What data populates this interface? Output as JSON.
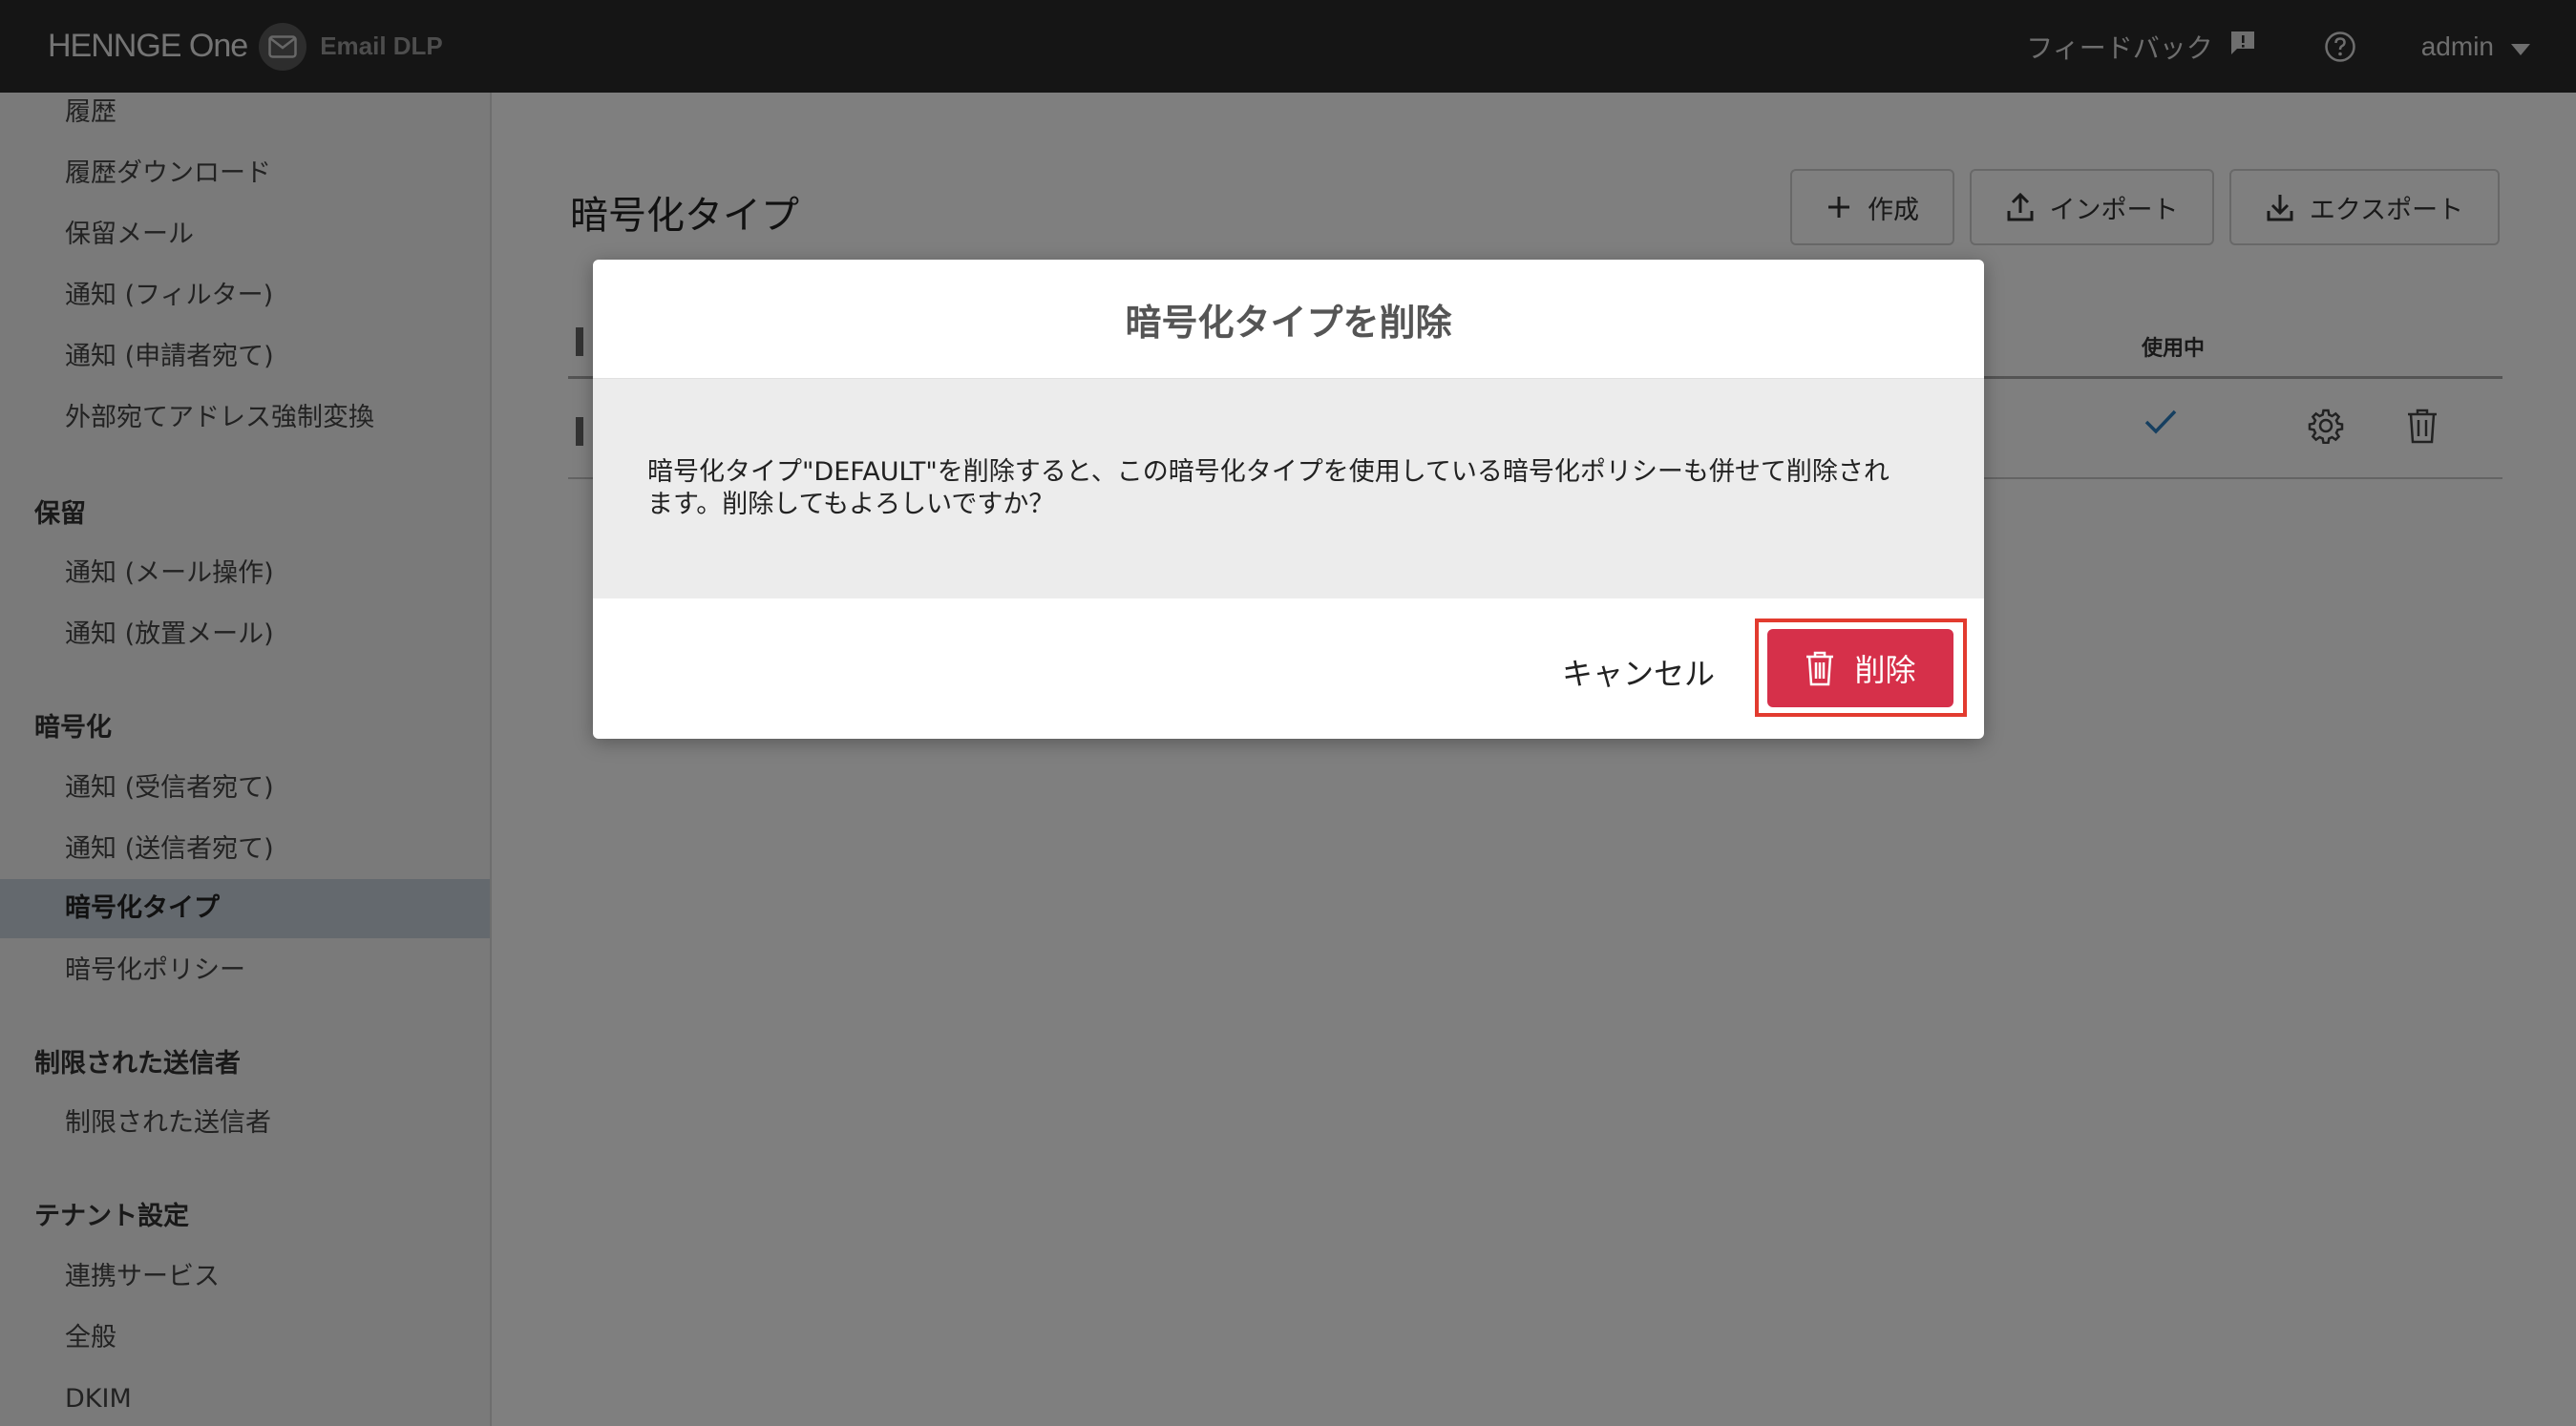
{
  "header": {
    "brand": "HENNGE One",
    "product": "Email DLP",
    "feedback_label": "フィードバック",
    "user": "admin"
  },
  "sidebar": {
    "items_top": [
      {
        "label": "履歴"
      },
      {
        "label": "履歴ダウンロード"
      },
      {
        "label": "保留メール"
      },
      {
        "label": "通知 (フィルター)"
      },
      {
        "label": "通知 (申請者宛て)"
      },
      {
        "label": "外部宛てアドレス強制変換"
      }
    ],
    "section_hold": "保留",
    "items_hold": [
      {
        "label": "通知 (メール操作)"
      },
      {
        "label": "通知 (放置メール)"
      }
    ],
    "section_encrypt": "暗号化",
    "items_encrypt": [
      {
        "label": "通知 (受信者宛て)"
      },
      {
        "label": "通知 (送信者宛て)"
      },
      {
        "label": "暗号化タイプ"
      },
      {
        "label": "暗号化ポリシー"
      }
    ],
    "section_restricted": "制限された送信者",
    "items_restricted": [
      {
        "label": "制限された送信者"
      }
    ],
    "section_tenant": "テナント設定",
    "items_tenant": [
      {
        "label": "連携サービス"
      },
      {
        "label": "全般"
      },
      {
        "label": "DKIM"
      }
    ]
  },
  "main": {
    "title": "暗号化タイプ",
    "create_label": "作成",
    "import_label": "インポート",
    "export_label": "エクスポート",
    "in_use_header": "使用中"
  },
  "modal": {
    "title": "暗号化タイプを削除",
    "message": "暗号化タイプ\"DEFAULT\"を削除すると、この暗号化タイプを使用している暗号化ポリシーも併せて削除されます。削除してもよろしいですか？",
    "cancel_label": "キャンセル",
    "delete_label": "削除"
  },
  "colors": {
    "topbar": "#2b2b2b",
    "danger": "#d6304a",
    "highlight": "#e23b2f",
    "check": "#2c7fc0"
  }
}
